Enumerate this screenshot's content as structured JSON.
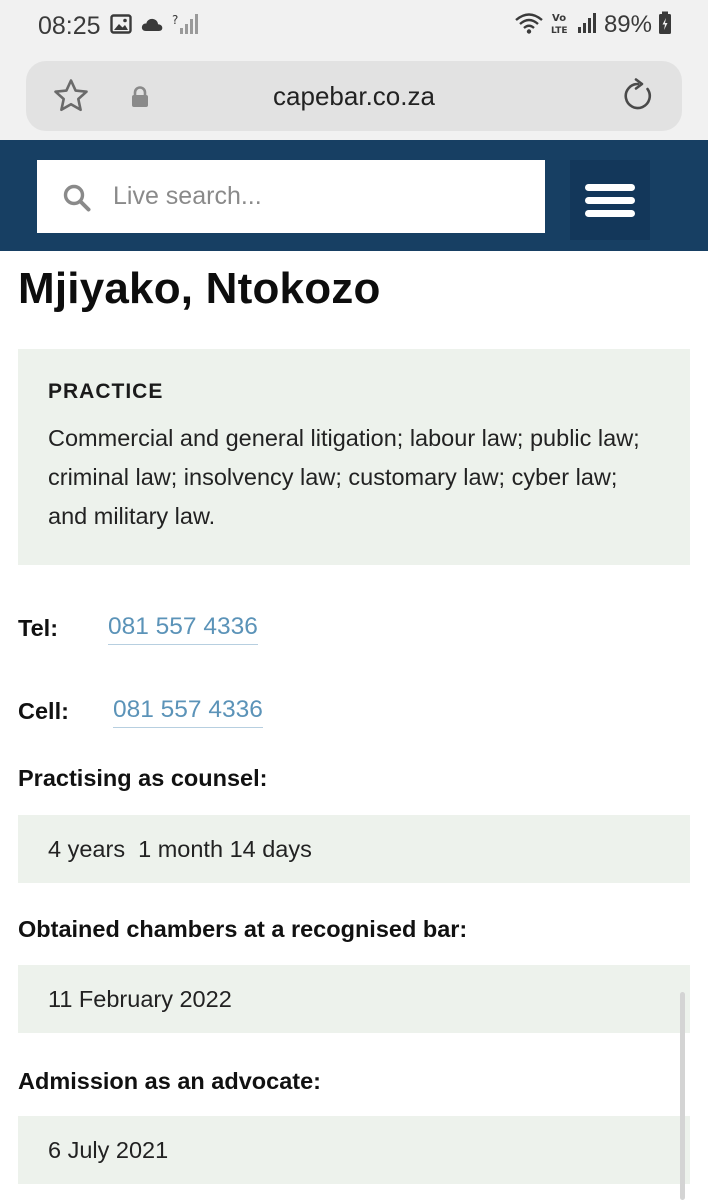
{
  "status_bar": {
    "time": "08:25",
    "battery": "89%",
    "icons_left": [
      "gallery-icon",
      "cloud-icon",
      "no-signal-icon"
    ],
    "icons_right": [
      "wifi-icon",
      "volte-icon",
      "signal-icon",
      "battery-icon"
    ]
  },
  "browser": {
    "url": "capebar.co.za"
  },
  "header": {
    "search_placeholder": "Live search...",
    "search_value": "",
    "colors": {
      "header_bg": "#173f63",
      "menu_bg": "#13375a"
    }
  },
  "profile": {
    "name": "Mjiyako, Ntokozo",
    "practice_heading": "PRACTICE",
    "practice_text": "Commercial and general litigation; labour law; public law; criminal law; insolvency law; customary law; cyber law; and military law.",
    "tel_label": "Tel:",
    "tel_value": "081 557 4336",
    "cell_label": "Cell:",
    "cell_value": "081 557 4336",
    "practising_label": "Practising as counsel:",
    "practising_value": "4 years  1 month 14 days",
    "chambers_label": "Obtained chambers at a recognised bar:",
    "chambers_value": "11 February 2022",
    "admission_label": "Admission as an advocate:",
    "admission_value": "6 July 2021"
  },
  "colors": {
    "panel_bg": "#edf2ec",
    "link": "#5b93b8"
  }
}
